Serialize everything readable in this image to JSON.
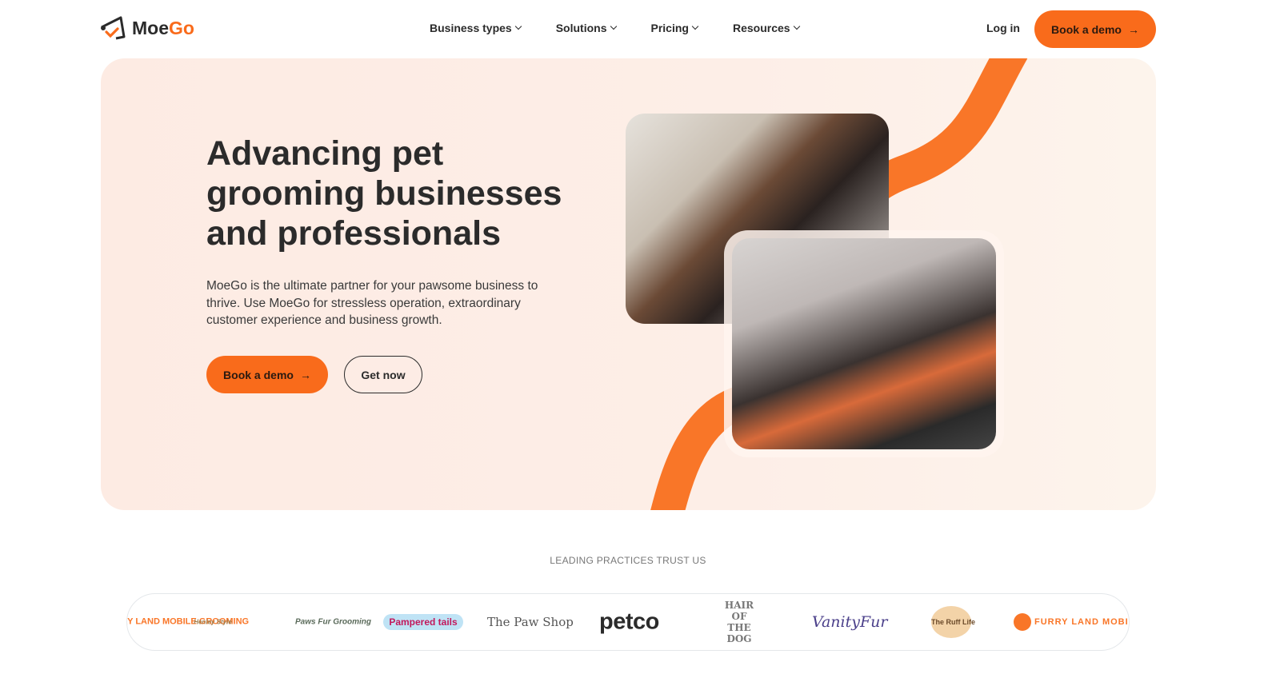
{
  "brand": {
    "name_part1": "Mo",
    "name_part2": "e",
    "name_part3": "Go",
    "accent": "#f96b1b"
  },
  "nav": {
    "items": [
      {
        "label": "Business types"
      },
      {
        "label": "Solutions"
      },
      {
        "label": "Pricing"
      },
      {
        "label": "Resources"
      }
    ],
    "login": "Log in",
    "demo": "Book a demo"
  },
  "hero": {
    "title": "Advancing pet grooming businesses and professionals",
    "description": "MoeGo is the ultimate partner for your pawsome business to thrive. Use MoeGo for stressless operation, extraordinary customer experience and business growth.",
    "demo": "Book a demo",
    "get_now": "Get now"
  },
  "trust": {
    "heading": "LEADING PRACTICES TRUST US",
    "logos": [
      "FURRY LAND MOBILE GROOMING",
      "Henley Style",
      "Paws Fur Grooming",
      "Pampered tails",
      "The Paw Shop",
      "petco",
      "HAIR OF THE DOG",
      "VanityFur",
      "The Ruff Life",
      "FURRY LAND MOBILE GROOMING"
    ]
  }
}
